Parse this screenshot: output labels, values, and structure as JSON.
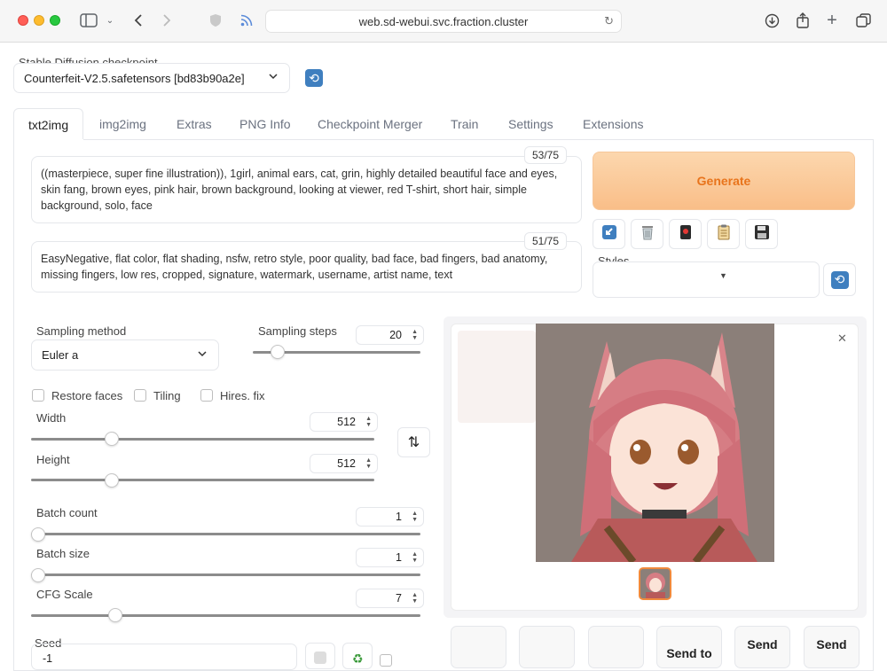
{
  "browser": {
    "url": "web.sd-webui.svc.fraction.cluster"
  },
  "checkpoint": {
    "label": "Stable Diffusion checkpoint",
    "value": "Counterfeit-V2.5.safetensors [bd83b90a2e]"
  },
  "tabs": [
    {
      "label": "txt2img",
      "active": true
    },
    {
      "label": "img2img"
    },
    {
      "label": "Extras"
    },
    {
      "label": "PNG Info"
    },
    {
      "label": "Checkpoint Merger"
    },
    {
      "label": "Train"
    },
    {
      "label": "Settings"
    },
    {
      "label": "Extensions"
    }
  ],
  "prompt": {
    "text": "((masterpiece, super fine illustration)), 1girl, animal ears, cat, grin, highly detailed beautiful face and eyes, skin fang, brown eyes, pink hair, brown background, looking at viewer, red T-shirt, short hair, simple background, solo, face",
    "counter": "53/75"
  },
  "negative_prompt": {
    "text": " EasyNegative, flat color, flat shading, nsfw, retro style, poor quality, bad face, bad fingers, bad anatomy, missing fingers, low res, cropped, signature, watermark, username, artist name, text",
    "counter": "51/75"
  },
  "generate_label": "Generate",
  "styles": {
    "label": "Styles"
  },
  "sampling": {
    "method_label": "Sampling method",
    "method_value": "Euler a",
    "steps_label": "Sampling steps",
    "steps_value": "20"
  },
  "checkboxes": {
    "restore_faces": "Restore faces",
    "tiling": "Tiling",
    "hires_fix": "Hires. fix"
  },
  "width": {
    "label": "Width",
    "value": "512"
  },
  "height": {
    "label": "Height",
    "value": "512"
  },
  "batch_count": {
    "label": "Batch count",
    "value": "1"
  },
  "batch_size": {
    "label": "Batch size",
    "value": "1"
  },
  "cfg_scale": {
    "label": "CFG Scale",
    "value": "7"
  },
  "seed": {
    "label": "Seed",
    "value": "-1"
  },
  "output_buttons": {
    "send_to": "Send to",
    "send_1": "Send",
    "send_2": "Send"
  },
  "colors": {
    "generate_text": "#e8741c",
    "accent_thumb_border": "#f08a3c"
  }
}
